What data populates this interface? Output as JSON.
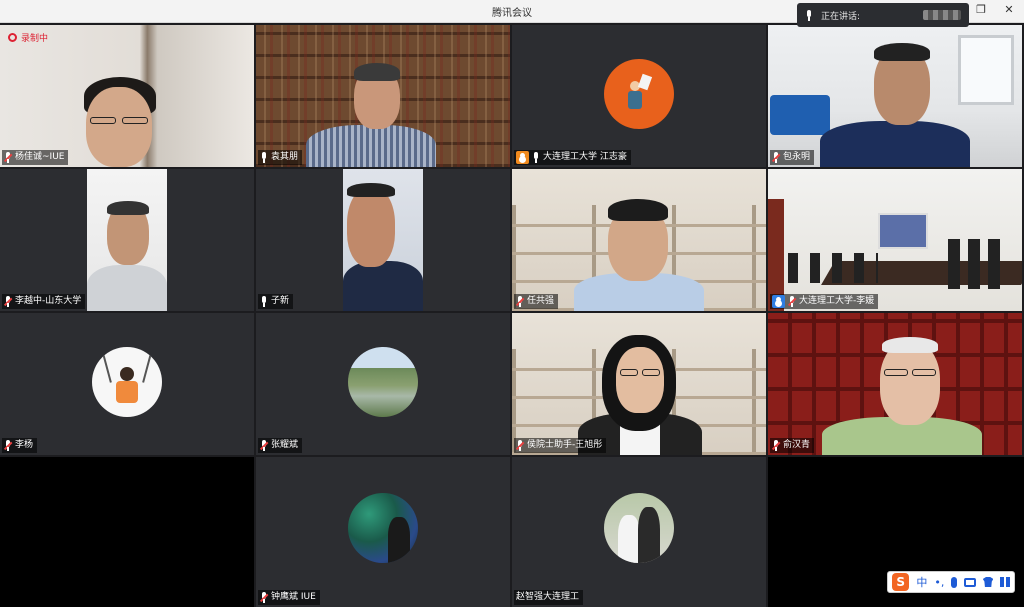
{
  "window": {
    "title": "腾讯会议",
    "controls": {
      "minimize": "─",
      "restore": "❐",
      "close": "✕"
    }
  },
  "speaking": {
    "label": "正在讲话:"
  },
  "recording": {
    "label": "录制中"
  },
  "participants": [
    {
      "name": "杨佳诚~IUE",
      "mic": "muted",
      "type": "video"
    },
    {
      "name": "袁其朋",
      "mic": "on",
      "type": "video"
    },
    {
      "name": "大连理工大学 江志豪",
      "mic": "on",
      "type": "avatar",
      "badge": "host"
    },
    {
      "name": "包永明",
      "mic": "muted",
      "type": "video"
    },
    {
      "name": "李越中-山东大学",
      "mic": "muted",
      "type": "video"
    },
    {
      "name": "子新",
      "mic": "on",
      "type": "video"
    },
    {
      "name": "任共强",
      "mic": "muted",
      "type": "video"
    },
    {
      "name": "大连理工大学-李媛",
      "mic": "muted",
      "type": "video",
      "badge": "cohost"
    },
    {
      "name": "李杨",
      "mic": "muted",
      "type": "avatar"
    },
    {
      "name": "张耀斌",
      "mic": "muted",
      "type": "avatar"
    },
    {
      "name": "侯院士助手-王旭彤",
      "mic": "muted",
      "type": "video"
    },
    {
      "name": "俞汉青",
      "mic": "muted",
      "type": "video"
    },
    {
      "name": "",
      "type": "empty"
    },
    {
      "name": "钟鹰斌 IUE",
      "mic": "muted",
      "type": "avatar"
    },
    {
      "name": "赵智强大连理工",
      "mic": "none",
      "type": "avatar"
    },
    {
      "name": "",
      "type": "empty"
    }
  ],
  "ime": {
    "logo": "S",
    "mode": "中",
    "punct": "•,",
    "icons": [
      "mic-icon",
      "keyboard-icon",
      "shirt-icon",
      "grid-icon"
    ]
  },
  "colors": {
    "tile": "#2c2d31",
    "host_orange": "#f08a1e",
    "cohost_blue": "#2f7de1",
    "muted_red": "#e84040"
  }
}
